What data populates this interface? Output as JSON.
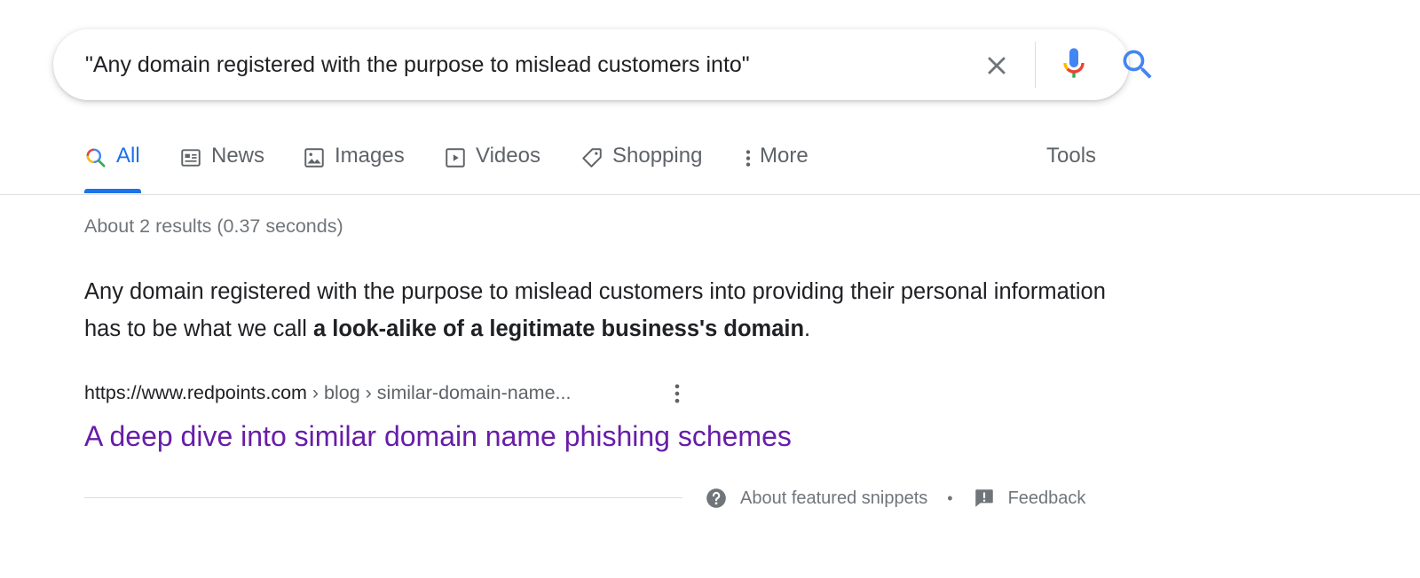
{
  "search": {
    "query": "\"Any domain registered with the purpose to mislead customers into\""
  },
  "tabs": [
    {
      "label": "All",
      "icon": "search-icon",
      "active": true
    },
    {
      "label": "News",
      "icon": "news-icon"
    },
    {
      "label": "Images",
      "icon": "image-icon"
    },
    {
      "label": "Videos",
      "icon": "video-icon"
    },
    {
      "label": "Shopping",
      "icon": "tag-icon"
    },
    {
      "label": "More",
      "icon": "more-vert-icon"
    }
  ],
  "tools_label": "Tools",
  "result_stats": "About 2 results (0.37 seconds)",
  "featured_snippet": {
    "text_plain": "Any domain registered with the purpose to mislead customers into providing their personal information has to be what we call ",
    "text_bold": "a look-alike of a legitimate business's domain",
    "text_end": "."
  },
  "result": {
    "url_base": "https://www.redpoints.com",
    "breadcrumb": " › blog › similar-domain-name...",
    "title": "A deep dive into similar domain name phishing schemes"
  },
  "footer": {
    "about_label": "About featured snippets",
    "separator": "•",
    "feedback_label": "Feedback"
  },
  "colors": {
    "accent": "#1a73e8",
    "visited_link": "#681da8",
    "muted_text": "#70757a"
  }
}
